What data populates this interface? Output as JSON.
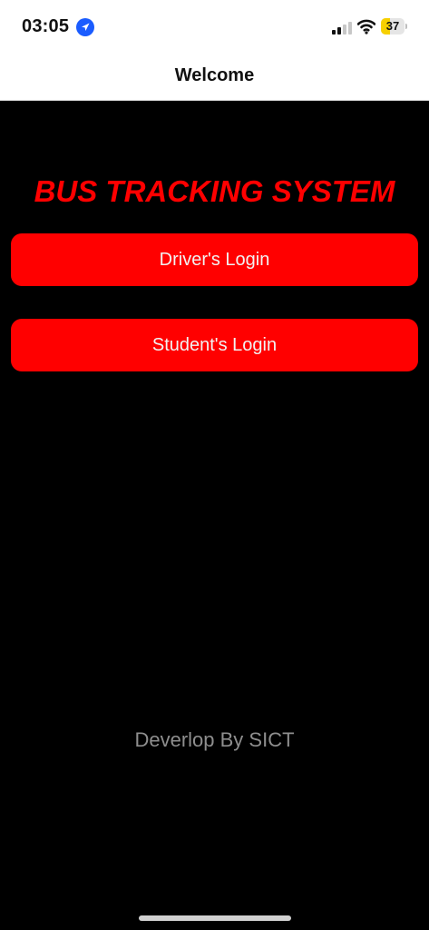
{
  "status_bar": {
    "time": "03:05",
    "location_icon": "location-arrow-icon",
    "signal_icon": "cellular-signal-icon",
    "wifi_icon": "wifi-icon",
    "battery_level": "37",
    "battery_fraction": 0.37,
    "battery_color": "#f7d000"
  },
  "nav": {
    "title": "Welcome"
  },
  "main": {
    "app_title": "BUS TRACKING SYSTEM",
    "driver_login_label": "Driver's Login",
    "student_login_label": "Student's Login",
    "footer_text": "Deverlop By SICT"
  },
  "colors": {
    "accent": "#ff0000",
    "background": "#000000",
    "button_text": "#f2f2f2",
    "footer_text": "#8e8e8e"
  }
}
